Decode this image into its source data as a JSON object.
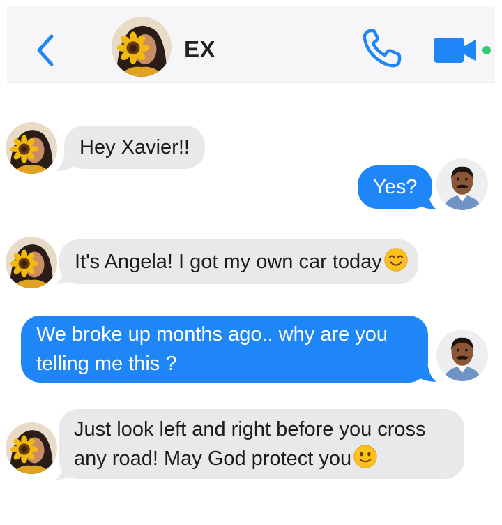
{
  "header": {
    "contact_name": "EX",
    "icons": {
      "back": "chevron-left-icon",
      "call": "phone-icon",
      "video": "video-camera-icon"
    },
    "accent_color": "#1e86f6",
    "online_color": "#2ecc71"
  },
  "messages": [
    {
      "sender": "contact",
      "text": "Hey Xavier!!"
    },
    {
      "sender": "me",
      "text": "Yes?"
    },
    {
      "sender": "contact",
      "text": "It's Angela! I got my own car today",
      "emoji": "smiling-face-icon"
    },
    {
      "sender": "me",
      "lines": [
        "We broke up months ago.. why are you",
        "telling me this ?"
      ]
    },
    {
      "sender": "contact",
      "lines": [
        "Just look left and right before you cross",
        "any road! May God protect you"
      ],
      "emoji": "slightly-smiling-face-icon"
    }
  ],
  "colors": {
    "incoming_bubble": "#e9e9eb",
    "outgoing_bubble": "#1e86f6",
    "header_bg": "#f6f6f8"
  }
}
